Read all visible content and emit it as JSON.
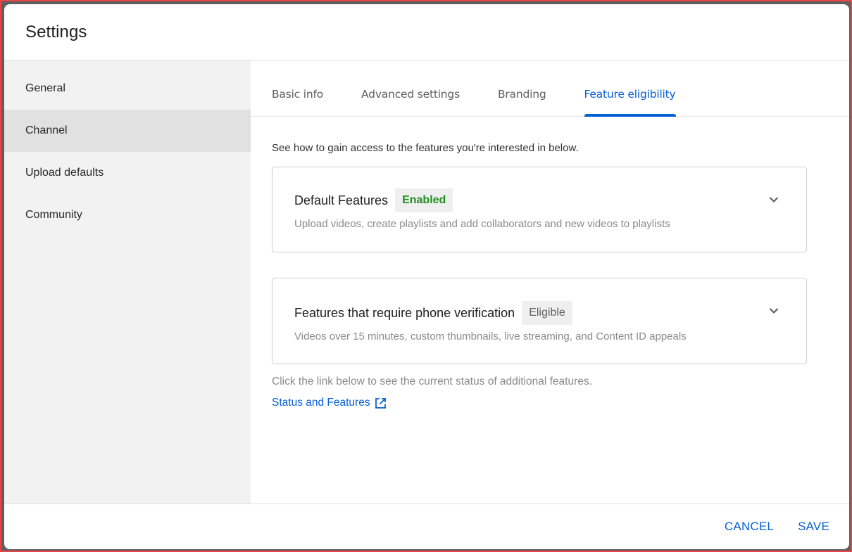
{
  "dialog": {
    "title": "Settings"
  },
  "sidebar": {
    "items": [
      {
        "label": "General",
        "active": false
      },
      {
        "label": "Channel",
        "active": true
      },
      {
        "label": "Upload defaults",
        "active": false
      },
      {
        "label": "Community",
        "active": false
      }
    ]
  },
  "tabs": [
    {
      "label": "Basic info",
      "active": false
    },
    {
      "label": "Advanced settings",
      "active": false
    },
    {
      "label": "Branding",
      "active": false
    },
    {
      "label": "Feature eligibility",
      "active": true
    }
  ],
  "content": {
    "intro": "See how to gain access to the features you're interested in below.",
    "cards": [
      {
        "title": "Default Features",
        "badge": "Enabled",
        "badge_status": "enabled",
        "badge_color": "#1e8e1e",
        "description": "Upload videos, create playlists and add collaborators and new videos to playlists",
        "icon": "chevron-down-icon"
      },
      {
        "title": "Features that require phone verification",
        "badge": "Eligible",
        "badge_status": "eligible",
        "badge_color": "#606060",
        "description": "Videos over 15 minutes, custom thumbnails, live streaming, and Content ID appeals",
        "icon": "chevron-down-icon"
      }
    ],
    "hint": "Click the link below to see the current status of additional features.",
    "link": {
      "label": "Status and Features",
      "icon": "open-in-new-icon"
    }
  },
  "footer": {
    "cancel_label": "CANCEL",
    "save_label": "SAVE"
  },
  "colors": {
    "accent": "#065fd4",
    "enabled": "#1e8e1e",
    "sidebar_bg": "#f2f2f2",
    "sidebar_active_bg": "#e1e1e1"
  }
}
